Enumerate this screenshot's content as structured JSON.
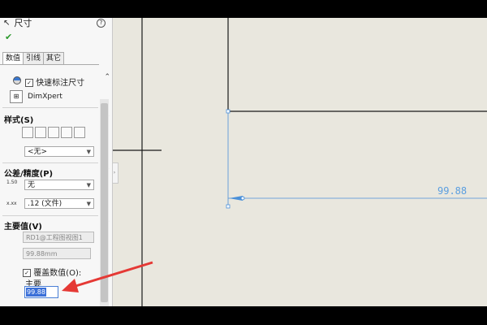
{
  "panel": {
    "title": "尺寸",
    "ok_symbol": "✔",
    "help_symbol": "?",
    "tabs": [
      "数值",
      "引线",
      "其它"
    ],
    "quick_dimension": {
      "checked": true,
      "label": "快速标注尺寸"
    },
    "dimxpert_label": "DimXpert",
    "style": {
      "title": "样式(S)",
      "select_value": "<无>"
    },
    "tolerance": {
      "title": "公差/精度(P)",
      "tolerance_value": "无",
      "precision_value": ".12 (文件)",
      "precision_icon_text": "x.xx",
      "tolerance_icon_text": "1.50"
    },
    "primary_value": {
      "title": "主要值(V)",
      "reference": "RD1@工程图视图1",
      "value": "99.88mm",
      "override": {
        "checked": true,
        "label": "覆盖数值(O):"
      },
      "primary_label": "主要",
      "edit_value": "99.88"
    }
  },
  "canvas": {
    "dimension_text": "99.88",
    "colors": {
      "line": "#1a1a1a",
      "dimension": "#4a90d9",
      "arrow": "#e53935",
      "background": "#e9e7de"
    }
  }
}
